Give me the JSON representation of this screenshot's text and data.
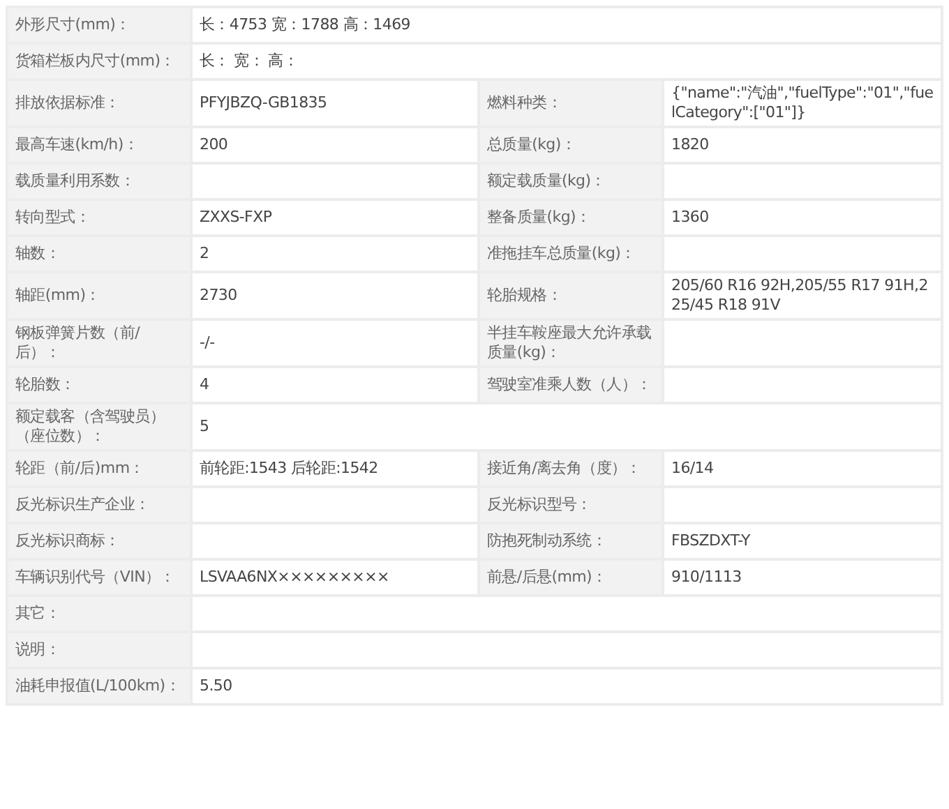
{
  "rows": [
    {
      "kind": "wide",
      "label": "外形尺寸(mm)：",
      "value": "长：4753 宽：1788 高：1469"
    },
    {
      "kind": "wide",
      "label": "货箱栏板内尺寸(mm)：",
      "value": "长： 宽： 高："
    },
    {
      "kind": "pair",
      "label": "排放依据标准：",
      "value": "PFYJBZQ-GB1835",
      "label_2": "燃料种类：",
      "value_2": "{\"name\":\"汽油\",\"fuelType\":\"01\",\"fuelCategory\":[\"01\"]}"
    },
    {
      "kind": "pair",
      "label": "最高车速(km/h)：",
      "value": "200",
      "label_2": "总质量(kg)：",
      "value_2": "1820"
    },
    {
      "kind": "pair",
      "label": "载质量利用系数：",
      "label_2": "额定载质量(kg)："
    },
    {
      "kind": "pair",
      "label": "转向型式：",
      "value": "ZXXS-FXP",
      "label_2": "整备质量(kg)：",
      "value_2": "1360"
    },
    {
      "kind": "pair",
      "label": "轴数：",
      "value": "2",
      "label_2": "准拖挂车总质量(kg)："
    },
    {
      "kind": "pair",
      "label": "轴距(mm)：",
      "value": "2730",
      "label_2": "轮胎规格：",
      "value_2": "205/60 R16 92H,205/55 R17 91H,225/45 R18 91V"
    },
    {
      "kind": "pair",
      "label": "钢板弹簧片数（前/后）：",
      "value": "-/-",
      "label_2": "半挂车鞍座最大允许承载质量(kg)："
    },
    {
      "kind": "pair",
      "label": "轮胎数：",
      "value": "4",
      "label_2": "驾驶室准乘人数（人）："
    },
    {
      "kind": "wide",
      "label": "额定载客（含驾驶员）（座位数）：",
      "value": "5"
    },
    {
      "kind": "pair",
      "label": "轮距（前/后)mm：",
      "value": "前轮距:1543 后轮距:1542",
      "label_2": "接近角/离去角（度）：",
      "value_2": "16/14"
    },
    {
      "kind": "pair",
      "label": "反光标识生产企业：",
      "label_2": "反光标识型号："
    },
    {
      "kind": "pair",
      "label": "反光标识商标：",
      "label_2": "防抱死制动系统：",
      "value_2": "FBSZDXT-Y"
    },
    {
      "kind": "pair",
      "label": "车辆识别代号（VIN）：",
      "value": "LSVAA6NX×××××××××",
      "label_2": "前悬/后悬(mm)：",
      "value_2": "910/1113"
    },
    {
      "kind": "wide",
      "label": "其它："
    },
    {
      "kind": "wide",
      "label": "说明："
    },
    {
      "kind": "wide",
      "label": "油耗申报值(L/100km)：",
      "value": "5.50"
    }
  ]
}
